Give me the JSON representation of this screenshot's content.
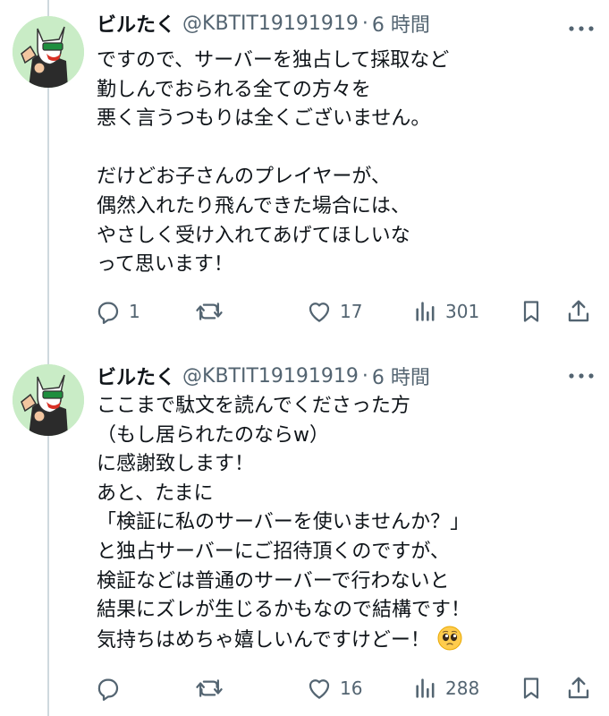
{
  "tweets": [
    {
      "author": {
        "display_name": "ビルたく",
        "handle": "@KBTIT19191919",
        "separator": "·",
        "time": "6 時間"
      },
      "lines": [
        "ですので、サーバーを独占して採取など",
        "勤しんでおられる全ての方々を",
        "悪く言うつもりは全くございません。",
        "",
        "だけどお子さんのプレイヤーが、",
        "偶然入れたり飛んできた場合には、",
        "やさしく受け入れてあげてほしいな",
        "って思います！"
      ],
      "metrics": {
        "replies": "1",
        "retweets": "",
        "likes": "17",
        "views": "301"
      }
    },
    {
      "author": {
        "display_name": "ビルたく",
        "handle": "@KBTIT19191919",
        "separator": "·",
        "time": "6 時間"
      },
      "lines": [
        "ここまで駄文を読んでくださった方",
        "（もし居られたのならw）",
        "に感謝致します！",
        "あと、たまに",
        "「検証に私のサーバーを使いませんか？」",
        "と独占サーバーにご招待頂くのですが、",
        "検証などは普通のサーバーで行わないと",
        "結果にズレが生じるかもなので結構です！",
        "気持ちはめちゃ嬉しいんですけどー！"
      ],
      "trailing_emoji": "pleading-face-emoji",
      "metrics": {
        "replies": "",
        "retweets": "",
        "likes": "16",
        "views": "288"
      }
    }
  ],
  "icons": {
    "reply": "reply-icon",
    "retweet": "retweet-icon",
    "like": "heart-icon",
    "views": "views-chart-icon",
    "bookmark": "bookmark-icon",
    "share": "share-icon",
    "more": "more-dots-icon"
  },
  "colors": {
    "text": "#0f1419",
    "secondary": "#536471",
    "thread_line": "#cfd9de",
    "avatar_bg": "#c9ecc6"
  }
}
